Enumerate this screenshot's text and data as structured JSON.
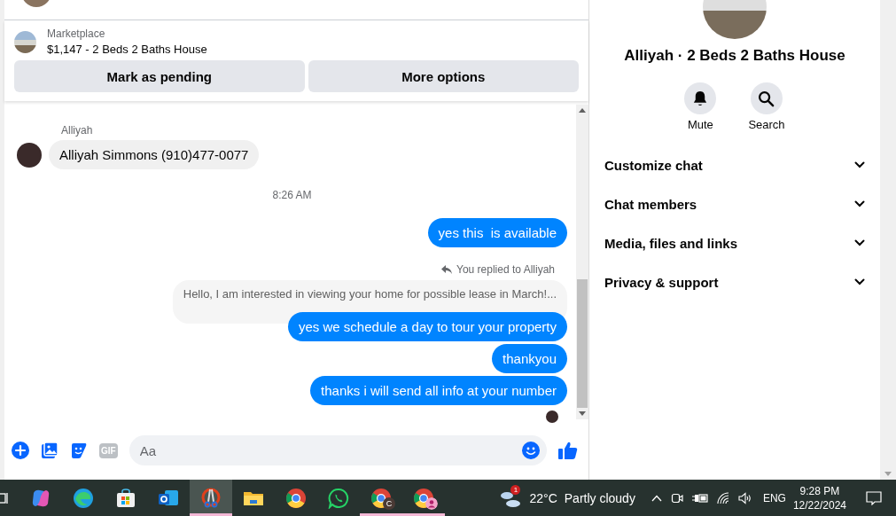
{
  "listing": {
    "label": "Marketplace",
    "title": "$1,147 - 2 Beds 2 Baths House"
  },
  "listing_buttons": [
    "Mark as pending",
    "More options"
  ],
  "messages": [
    {
      "kind": "sender",
      "text": "Alliyah"
    },
    {
      "kind": "incoming",
      "text": "Alliyah Simmons (910)477-0077"
    },
    {
      "kind": "timestamp",
      "text": "8:26 AM"
    },
    {
      "kind": "outgoing",
      "text": "yes this  is available"
    },
    {
      "kind": "reply_label",
      "text": "You replied to Alliyah"
    },
    {
      "kind": "quote",
      "text": "Hello, I am interested in viewing your home for possible lease in March!..."
    },
    {
      "kind": "outgoing",
      "text": "yes we schedule a day to tour your property"
    },
    {
      "kind": "outgoing",
      "text": "thankyou"
    },
    {
      "kind": "outgoing",
      "text": "thanks i will send all info at your number"
    },
    {
      "kind": "seen"
    }
  ],
  "composer": {
    "gif_label": "GIF",
    "placeholder": "Aa"
  },
  "details": {
    "title": "Alliyah · 2 Beds 2 Baths House",
    "actions": [
      {
        "kind": "mute",
        "label": "Mute"
      },
      {
        "kind": "search",
        "label": "Search"
      }
    ],
    "sections": [
      {
        "label": "Customize chat",
        "expanded": false
      },
      {
        "label": "Chat members",
        "expanded": false
      },
      {
        "label": "Media, files and links",
        "expanded": false
      },
      {
        "label": "Privacy & support",
        "expanded": false
      }
    ]
  },
  "taskbar": {
    "apps": [
      {
        "kind": "swirl",
        "selected": false,
        "running": false
      },
      {
        "kind": "wave",
        "selected": false,
        "running": false
      },
      {
        "kind": "bag",
        "selected": false,
        "running": false
      },
      {
        "kind": "mail",
        "selected": false,
        "running": false
      },
      {
        "kind": "scissors",
        "selected": true,
        "running": true
      },
      {
        "kind": "folder",
        "selected": false,
        "running": false
      },
      {
        "kind": "browser",
        "selected": false,
        "running": false
      },
      {
        "kind": "phone",
        "selected": false,
        "running": false
      },
      {
        "kind": "browser",
        "selected": false,
        "running": true,
        "badge": {
          "kind": "letter",
          "text": "C"
        }
      },
      {
        "kind": "browser",
        "selected": false,
        "running": true,
        "badge": {
          "kind": "person"
        }
      }
    ],
    "weather": {
      "badge": "1",
      "temperature": "22°C",
      "condition": "Partly cloudy"
    },
    "language": "ENG",
    "time": "9:28 PM",
    "date": "12/22/2024"
  }
}
